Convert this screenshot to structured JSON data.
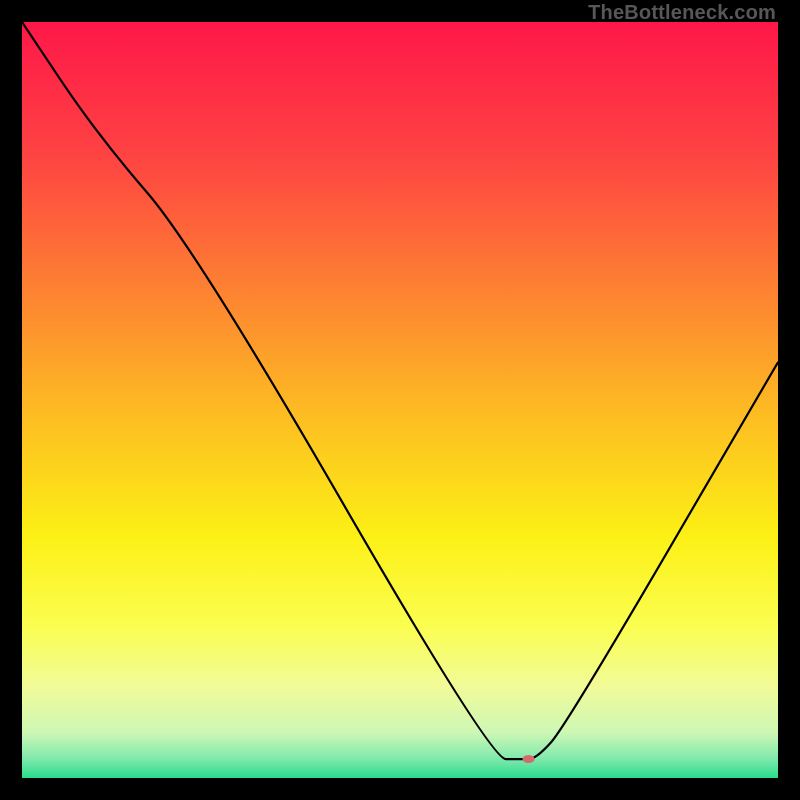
{
  "watermark": "TheBottleneck.com",
  "chart_data": {
    "type": "line",
    "title": "",
    "xlabel": "",
    "ylabel": "",
    "xlim": [
      0,
      100
    ],
    "ylim": [
      0,
      100
    ],
    "grid": false,
    "legend": false,
    "series": [
      {
        "name": "bottleneck-curve",
        "x": [
          0,
          10,
          23,
          62,
          66,
          68,
          72,
          100
        ],
        "y": [
          100,
          85,
          70,
          2.5,
          2.5,
          2.5,
          7,
          55
        ]
      }
    ],
    "marker": {
      "x": 67,
      "y": 2.5,
      "color": "#d46a6a",
      "rx": 6,
      "ry": 4
    },
    "background_gradient": {
      "stops": [
        {
          "offset": 0.0,
          "color": "#fe1749"
        },
        {
          "offset": 0.18,
          "color": "#fe4442"
        },
        {
          "offset": 0.35,
          "color": "#fd8032"
        },
        {
          "offset": 0.52,
          "color": "#fdbd22"
        },
        {
          "offset": 0.68,
          "color": "#fcf015"
        },
        {
          "offset": 0.8,
          "color": "#fbfe51"
        },
        {
          "offset": 0.88,
          "color": "#f0fb99"
        },
        {
          "offset": 0.94,
          "color": "#cdf7b5"
        },
        {
          "offset": 0.975,
          "color": "#7ee9ac"
        },
        {
          "offset": 1.0,
          "color": "#28dc8c"
        }
      ]
    }
  }
}
